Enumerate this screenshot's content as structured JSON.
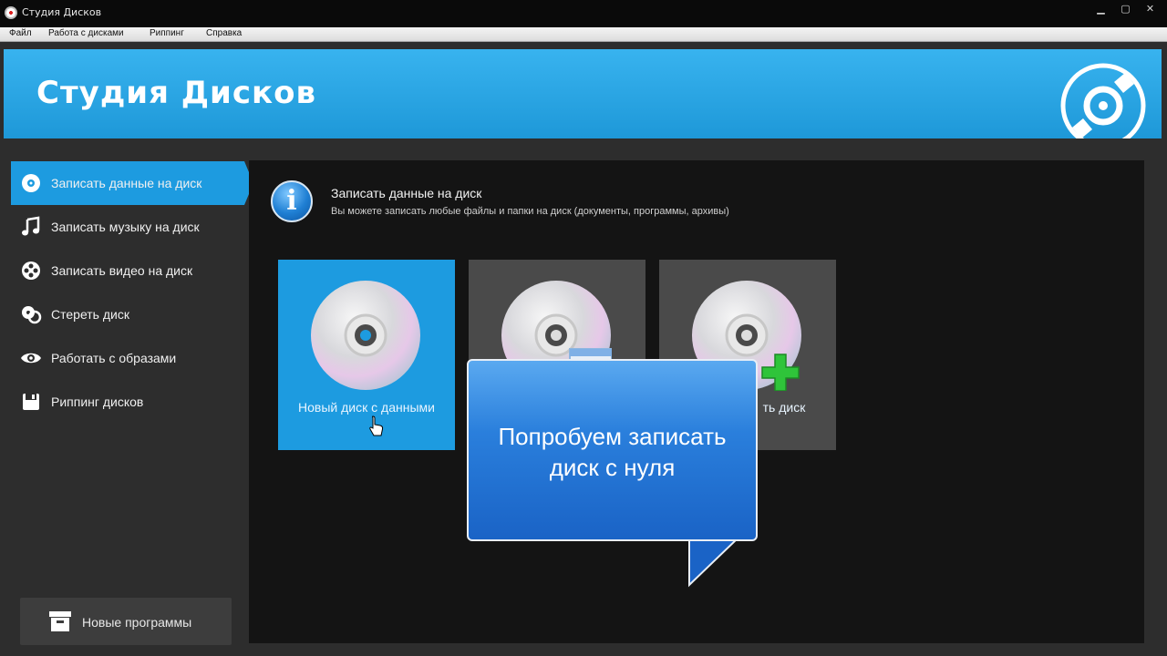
{
  "window": {
    "title": "Студия Дисков",
    "controls": {
      "minimize": "▁",
      "maximize": "▢",
      "close": "✕"
    }
  },
  "menu": [
    "Файл",
    "Работа с дисками",
    "Риппинг",
    "Справка"
  ],
  "header": {
    "title": "Студия Дисков",
    "logo_icon": "disc-logo-icon"
  },
  "sidebar": {
    "items": [
      {
        "label": "Записать данные на диск",
        "icon": "disc-icon",
        "active": true
      },
      {
        "label": "Записать музыку на диск",
        "icon": "music-note-icon",
        "active": false
      },
      {
        "label": "Записать видео на диск",
        "icon": "film-reel-icon",
        "active": false
      },
      {
        "label": "Стереть диск",
        "icon": "erase-disc-icon",
        "active": false
      },
      {
        "label": "Работать с образами",
        "icon": "eye-icon",
        "active": false
      },
      {
        "label": "Риппинг дисков",
        "icon": "rip-disc-icon",
        "active": false
      }
    ],
    "new_programs": {
      "label": "Новые программы",
      "icon": "box-icon"
    }
  },
  "main": {
    "info": {
      "title": "Записать данные на диск",
      "subtitle": "Вы можете записать любые файлы и папки на диск (документы, программы, архивы)"
    },
    "tiles": [
      {
        "label": "Новый диск с данными",
        "selected": true,
        "icon": "cd-icon"
      },
      {
        "label": "",
        "selected": false,
        "icon": "cd-with-window-icon"
      },
      {
        "label": "ть диск",
        "selected": false,
        "icon": "cd-plus-icon"
      }
    ]
  },
  "callout": {
    "line1": "Попробуем записать",
    "line2": "диск с нуля"
  },
  "colors": {
    "accent": "#1d9be0",
    "header": "#38b3ef",
    "background": "#2d2d2d",
    "panel": "#141414"
  }
}
